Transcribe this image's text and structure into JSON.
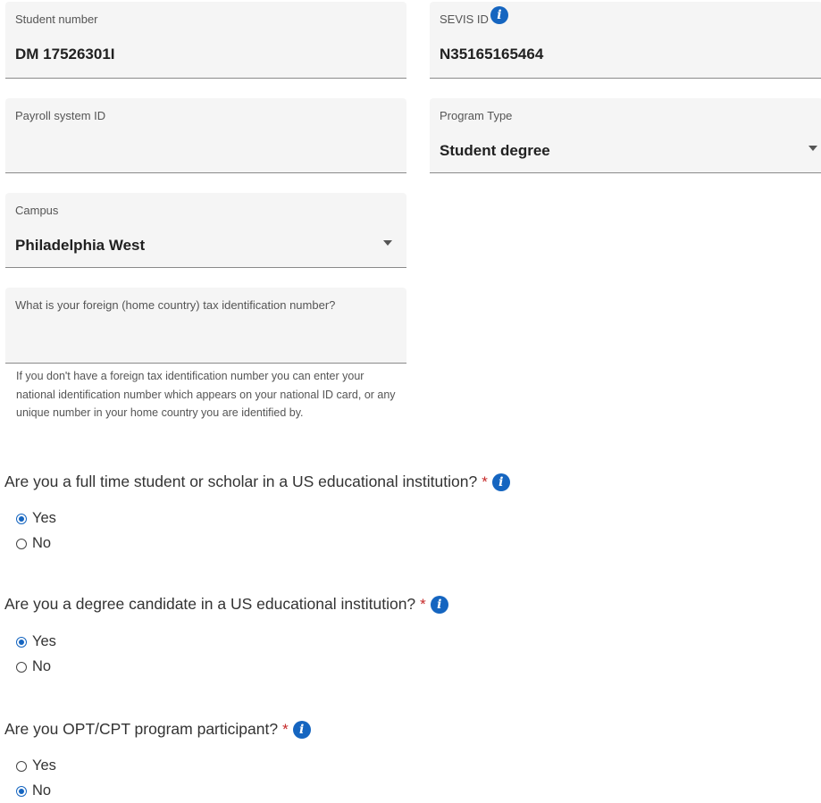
{
  "fields": {
    "student_number": {
      "label": "Student number",
      "value": "DM 17526301I"
    },
    "sevis_id": {
      "label": "SEVIS ID",
      "value": "N35165165464"
    },
    "payroll": {
      "label": "Payroll system ID",
      "value": ""
    },
    "program_type": {
      "label": "Program Type",
      "value": "Student degree"
    },
    "campus": {
      "label": "Campus",
      "value": "Philadelphia West"
    },
    "foreign_tax": {
      "label": "What is your foreign (home country) tax identification number?",
      "value": ""
    }
  },
  "help_text": "If you don't have a foreign tax identification number you can enter your national identification number which appears on your national ID card, or any unique number in your home country you are identified by.",
  "questions": [
    {
      "text": "Are you a full time student or scholar in a US educational institution?",
      "required_mark": "*",
      "options": [
        "Yes",
        "No"
      ],
      "selected": "Yes"
    },
    {
      "text": "Are you a degree candidate in a US educational institution?",
      "required_mark": "*",
      "options": [
        "Yes",
        "No"
      ],
      "selected": "Yes"
    },
    {
      "text": "Are you OPT/CPT program participant?",
      "required_mark": "*",
      "options": [
        "Yes",
        "No"
      ],
      "selected": "No"
    }
  ],
  "icons": {
    "info": "info-icon",
    "dropdown": "caret-down-icon",
    "radio": "radio-icon"
  },
  "colors": {
    "accent": "#1565c0",
    "required": "#c62828",
    "field_bg": "#f5f5f5"
  }
}
